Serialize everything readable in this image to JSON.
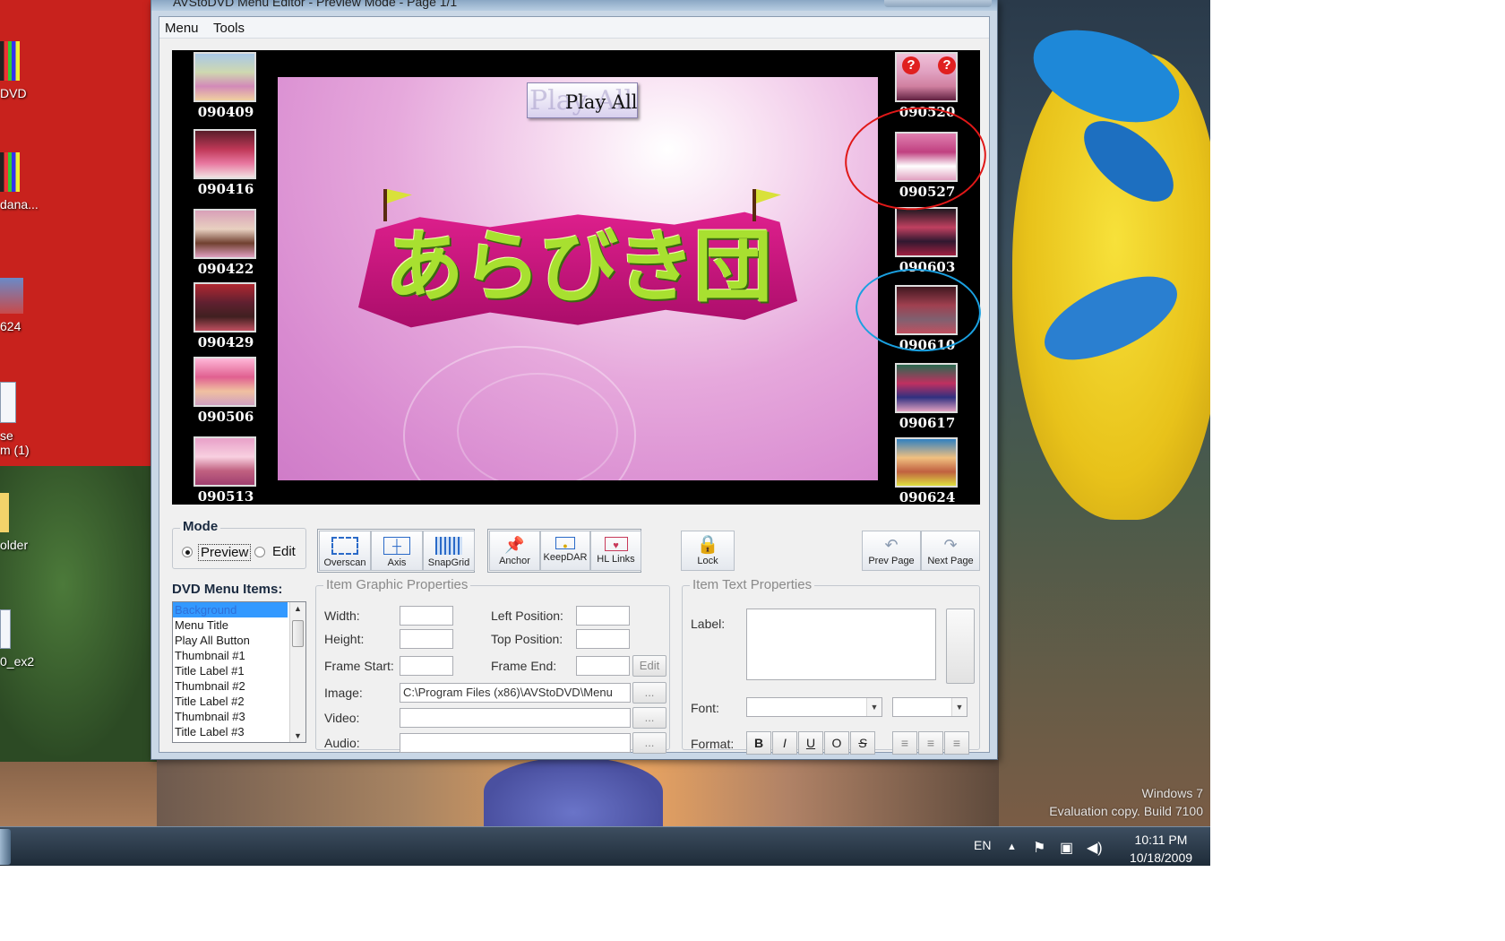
{
  "window": {
    "title": "AVStoDVD Menu Editor - Preview Mode - Page 1/1",
    "menubar": [
      "Menu",
      "Tools"
    ]
  },
  "preview": {
    "play_all_label": "Play All",
    "play_all_ghost": "Play All",
    "logo_text": "あらびき団",
    "thumbnails_left": [
      "090409",
      "090416",
      "090422",
      "090429",
      "090506",
      "090513"
    ],
    "thumbnails_right": [
      "090520",
      "090527",
      "090603",
      "090610",
      "090617",
      "090624"
    ],
    "annotations": {
      "red_circle_around": "090527",
      "blue_circle_around": "090610"
    }
  },
  "toolbar": {
    "mode": {
      "title": "Mode",
      "options": [
        "Preview",
        "Edit"
      ],
      "selected": "Preview"
    },
    "buttons": {
      "overscan": "Overscan",
      "axis": "Axis",
      "snapgrid": "SnapGrid",
      "anchor": "Anchor",
      "keepdar": "KeepDAR",
      "hllinks": "HL Links",
      "lock": "Lock",
      "prev_page": "Prev Page",
      "next_page": "Next Page"
    }
  },
  "items_list": {
    "title": "DVD Menu Items:",
    "items": [
      "Background",
      "Menu Title",
      "Play All Button",
      "Thumbnail #1",
      "Title Label #1",
      "Thumbnail #2",
      "Title Label #2",
      "Thumbnail #3",
      "Title Label #3"
    ],
    "selected": "Background"
  },
  "graphic_props": {
    "title": "Item Graphic Properties",
    "width_label": "Width:",
    "height_label": "Height:",
    "left_label": "Left Position:",
    "top_label": "Top Position:",
    "frame_start_label": "Frame Start:",
    "frame_end_label": "Frame End:",
    "edit_button": "Edit",
    "image_label": "Image:",
    "image_value": "C:\\Program Files (x86)\\AVStoDVD\\Menu",
    "video_label": "Video:",
    "audio_label": "Audio:",
    "browse_label": "..."
  },
  "text_props": {
    "title": "Item Text Properties",
    "label_label": "Label:",
    "font_label": "Font:",
    "format_label": "Format:",
    "format_buttons": [
      "B",
      "I",
      "U",
      "O",
      "S"
    ],
    "align_buttons": [
      "≡",
      "≡",
      "≡"
    ]
  },
  "desktop": {
    "icons": [
      "DVD",
      "dana...",
      "624",
      "se",
      "m (1)",
      "older",
      "0_ex2"
    ],
    "watermark_line1": "Windows 7",
    "watermark_line2": "Evaluation copy. Build 7100"
  },
  "taskbar": {
    "language": "EN",
    "time": "10:11 PM",
    "date": "10/18/2009"
  },
  "colors": {
    "window_frame": "#c9d7e6",
    "preview_background": "#d88ad0",
    "annotation_red": "#e01818",
    "annotation_blue": "#1aa0e0",
    "list_selection": "#3399ff"
  }
}
